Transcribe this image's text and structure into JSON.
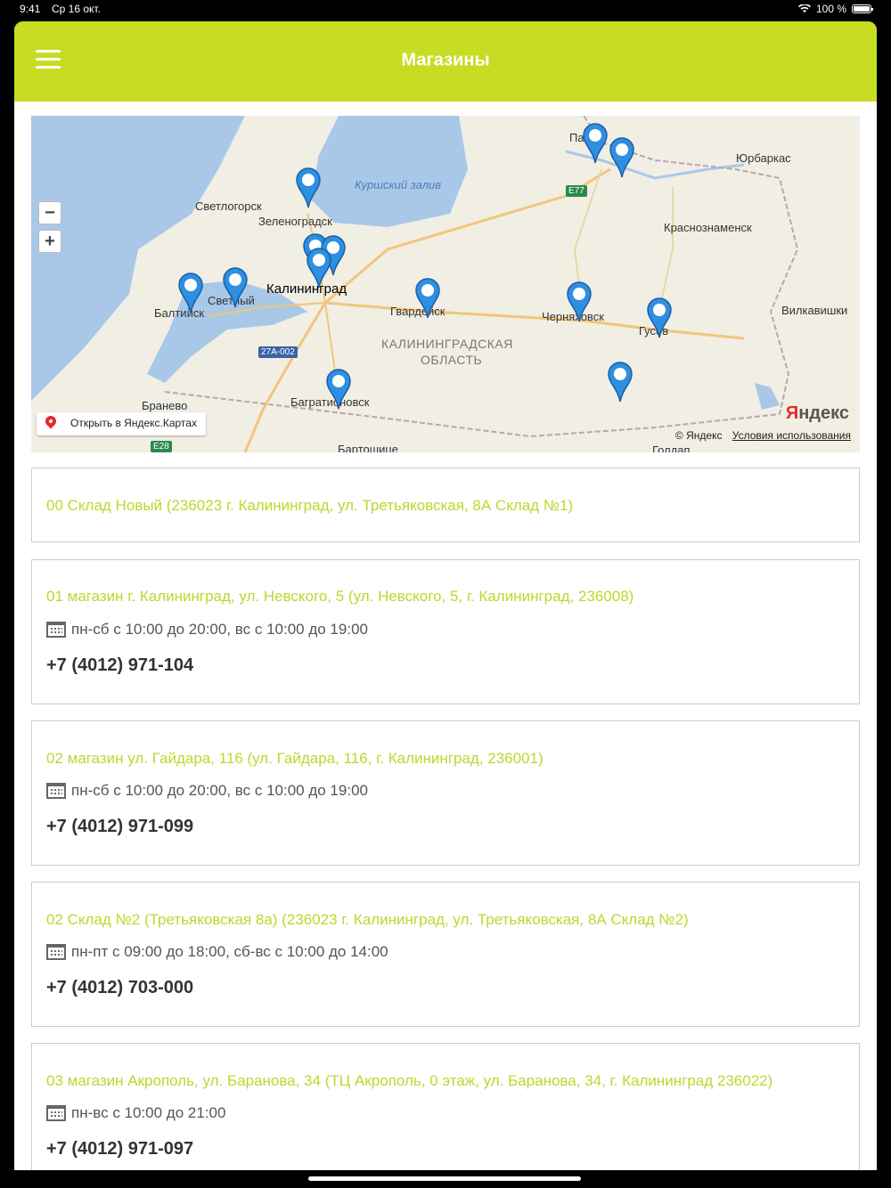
{
  "status": {
    "time": "9:41",
    "date": "Ср 16 окт.",
    "battery": "100 %"
  },
  "header": {
    "title": "Магазины",
    "menu_icon": "hamburger-menu-icon"
  },
  "map": {
    "open_button": "Открыть в Яндекс.Картах",
    "copyright": "© Яндекс",
    "terms": "Условия использования",
    "logo": "Яндекс",
    "labels": {
      "kurshsky": "Куршский залив",
      "svetlogorsk": "Светлогорск",
      "zelenogradsk": "Зеленоградск",
      "kaliningrad": "Калининград",
      "baltiysk": "Балтийск",
      "svetly": "Светлый",
      "gvardeysk": "Гвардейск",
      "chernyakhovsk": "Черняховск",
      "gusev": "Гусев",
      "region1": "КАЛИНИНГРАДСКАЯ",
      "region2": "ОБЛАСТЬ",
      "bagrationovsk": "Багратионовск",
      "branevo": "Бранево",
      "bartoszyce": "Бартошице",
      "jurbarkas": "Юрбаркас",
      "krasnoznamensk": "Краснознаменск",
      "vilkaviskis": "Вилкавишки",
      "sovetsk": "Пагег",
      "goldap": "Голдап",
      "road_e77": "E77",
      "road_27a": "27A-002",
      "road_e28": "E28"
    }
  },
  "stores": [
    {
      "name": "00 Склад Новый (236023 г. Калининград, ул. Третьяковская, 8А Склад №1)",
      "hours": "",
      "phone": ""
    },
    {
      "name": "01 магазин г. Калининград, ул. Невского, 5 (ул. Невского, 5, г. Калининград, 236008)",
      "hours": "пн-сб с 10:00 до 20:00, вс с 10:00 до 19:00",
      "phone": "+7 (4012) 971-104"
    },
    {
      "name": "02 магазин ул. Гайдара, 116 (ул. Гайдара, 116, г. Калининград, 236001)",
      "hours": "пн-сб с 10:00 до 20:00, вс с 10:00 до 19:00",
      "phone": "+7 (4012) 971-099"
    },
    {
      "name": "02 Склад №2 (Третьяковская 8а) (236023 г. Калининград, ул. Третьяковская, 8А Склад №2)",
      "hours": "пн-пт с 09:00 до 18:00, сб-вс с 10:00 до 14:00",
      "phone": "+7 (4012) 703-000"
    },
    {
      "name": "03 магазин Акрополь, ул. Баранова, 34 (ТЦ Акрополь, 0 этаж, ул. Баранова, 34, г. Калининград 236022)",
      "hours": "пн-вс с 10:00 до 21:00",
      "phone": "+7 (4012) 971-097"
    }
  ]
}
